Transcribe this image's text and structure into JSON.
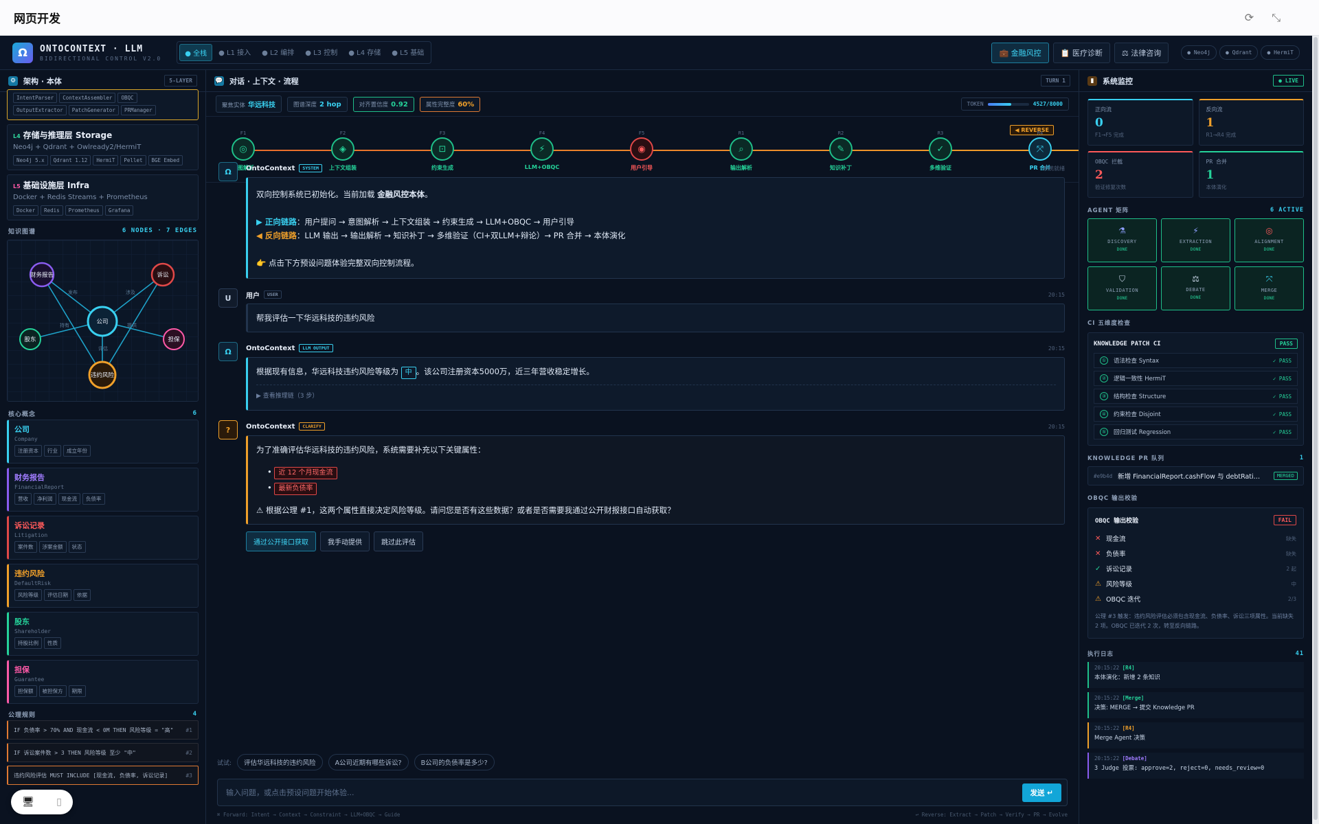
{
  "window": {
    "title": "网页开发",
    "refresh_icon": "⟳",
    "collapse_icon": "⤡"
  },
  "header": {
    "logo": "Ω",
    "name": "ONTOCONTEXT · LLM",
    "sub": "BIDIRECTIONAL CONTROL V2.0",
    "layers": [
      "● 全栈",
      "● L1 接入",
      "● L2 编排",
      "● L3 控制",
      "● L4 存储",
      "● L5 基础"
    ],
    "domains": [
      "💼 金融风控",
      "📋 医疗诊断",
      "⚖ 法律咨询"
    ],
    "services": [
      "● Neo4j",
      "● Qdrant",
      "● HermiT"
    ]
  },
  "left": {
    "title": "架构 · 本体",
    "tag": "5-LAYER",
    "top_chips": [
      "IntentParser",
      "ContextAssembler",
      "OBQC",
      "OutputExtractor",
      "PatchGenerator",
      "PRManager"
    ],
    "layers": [
      {
        "no": "L4",
        "name": "存储与推理层 Storage",
        "desc": "Neo4j + Qdrant + Owlready2/HermiT",
        "chips": [
          "Neo4j 5.x",
          "Qdrant 1.12",
          "HermiT",
          "Pellet",
          "BGE Embed"
        ],
        "color": "#2fd49c"
      },
      {
        "no": "L5",
        "name": "基础设施层 Infra",
        "desc": "Docker + Redis Streams + Prometheus",
        "chips": [
          "Docker",
          "Redis",
          "Prometheus",
          "Grafana"
        ],
        "color": "#ff5aa8"
      }
    ],
    "graph_title": "知识图谱",
    "graph_count": "6 NODES · 7 EDGES",
    "nodes": [
      {
        "label": "财务报告",
        "color": "#8a5cf0"
      },
      {
        "label": "诉讼",
        "color": "#e04848"
      },
      {
        "label": "公司",
        "color": "#39d0f0"
      },
      {
        "label": "股东",
        "color": "#25d39a"
      },
      {
        "label": "担保",
        "color": "#ff5aa8"
      },
      {
        "label": "违约风险",
        "color": "#f0a02a"
      }
    ],
    "edges": [
      "发布",
      "涉及",
      "持有",
      "提供",
      "评估"
    ],
    "concepts_title": "核心概念",
    "concepts_count": "6",
    "concepts": [
      {
        "name": "公司",
        "en": "Company",
        "attrs": [
          "注册资本",
          "行业",
          "成立年份"
        ],
        "color": "#39d0f0"
      },
      {
        "name": "财务报告",
        "en": "FinancialReport",
        "attrs": [
          "营收",
          "净利润",
          "现金流",
          "负债率"
        ],
        "color": "#8a5cf0"
      },
      {
        "name": "诉讼记录",
        "en": "Litigation",
        "attrs": [
          "案件数",
          "涉案金额",
          "状态"
        ],
        "color": "#e04848"
      },
      {
        "name": "违约风险",
        "en": "DefaultRisk",
        "attrs": [
          "风险等级",
          "评估日期",
          "依据"
        ],
        "color": "#f0a02a"
      },
      {
        "name": "股东",
        "en": "Shareholder",
        "attrs": [
          "持股比例",
          "性质"
        ],
        "color": "#25d39a"
      },
      {
        "name": "担保",
        "en": "Guarantee",
        "attrs": [
          "担保额",
          "被担保方",
          "期限"
        ],
        "color": "#ff5aa8"
      }
    ],
    "axioms_title": "公理规则",
    "axioms_count": "4",
    "axioms": [
      {
        "text": "IF 负债率 > 70% AND 现金流 < 0M THEN 风险等级 = \"高\"",
        "n": "#1"
      },
      {
        "text": "IF 诉讼案件数 > 3 THEN 风险等级 至少 \"中\"",
        "n": "#2"
      },
      {
        "text": "违约风险评估 MUST INCLUDE [现金流, 负债率, 诉讼记录]",
        "n": "#3"
      }
    ]
  },
  "center": {
    "title": "对话 · 上下文 · 流程",
    "turn": "TURN 1",
    "metrics": [
      {
        "label": "聚焦实体",
        "value": "华远科技",
        "color": "#39d0f0"
      },
      {
        "label": "图谱深度",
        "value": "2 hop",
        "color": "#39d0f0"
      },
      {
        "label": "对齐置信度",
        "value": "0.92",
        "color": "#25d39a"
      },
      {
        "label": "属性完整度",
        "value": "60%",
        "color": "#f0a02a"
      }
    ],
    "token_label": "TOKEN",
    "token_value": "4527/8000",
    "token_fill": 0.566,
    "reverse": "◀ REVERSE",
    "stages": [
      {
        "p": "F1",
        "label": "意图解析",
        "icon": "◎",
        "state": "done"
      },
      {
        "p": "F2",
        "label": "上下文组装",
        "icon": "◈",
        "state": "done"
      },
      {
        "p": "F3",
        "label": "约束生成",
        "icon": "⊡",
        "state": "done"
      },
      {
        "p": "F4",
        "label": "LLM+OBQC",
        "icon": "⚡",
        "state": "done"
      },
      {
        "p": "F5",
        "label": "用户引导",
        "icon": "◉",
        "state": "active"
      },
      {
        "p": "R1",
        "label": "输出解析",
        "icon": "⌕",
        "state": "done"
      },
      {
        "p": "R2",
        "label": "知识补丁",
        "icon": "✎",
        "state": "done"
      },
      {
        "p": "R3",
        "label": "多维验证",
        "icon": "✓",
        "state": "done"
      },
      {
        "p": "R4",
        "label": "PR 合并",
        "icon": "⤧",
        "state": "current"
      }
    ],
    "messages": {
      "m1": {
        "who": "OntoContext",
        "role": "SYSTEM",
        "time": "系统就绪",
        "l1a": "双向控制系统已初始化。当前加载 ",
        "l1b": "金融风控本体",
        "l1c": "。",
        "l2a": "▶ 正向链路",
        "l2b": "：用户提问 → 意图解析 → 上下文组装 → 约束生成 → LLM+OBQC → 用户引导",
        "l3a": "◀ 反向链路",
        "l3b": "：LLM 输出 → 输出解析 → 知识补丁 → 多维验证（CI+双LLM+辩论）→ PR 合并 → 本体演化",
        "l4": "👉 点击下方预设问题体验完整双向控制流程。"
      },
      "m2": {
        "who": "用户",
        "role": "USER",
        "time": "20:15",
        "avatar": "U",
        "text": "帮我评估一下华远科技的违约风险"
      },
      "m3": {
        "who": "OntoContext",
        "role": "LLM OUTPUT",
        "time": "20:15",
        "a": "根据现有信息，华远科技违约风险等级为 ",
        "hl": "中",
        "b": "。该公司注册资本5000万，近三年营收稳定增长。",
        "reason": "▶ 查看推理链（3 步）"
      },
      "m4": {
        "who": "OntoContext",
        "role": "CLARIFY",
        "time": "20:15",
        "avatar": "?",
        "intro": "为了准确评估华远科技的违约风险，系统需要补充以下关键属性：",
        "items": [
          "近 12 个月现金流",
          "最新负债率"
        ],
        "warn": "⚠ 根据公理 #1，这两个属性直接决定风险等级。请问您是否有这些数据？或者是否需要我通过公开财报接口自动获取？",
        "actions": [
          "通过公开接口获取",
          "我手动提供",
          "跳过此评估"
        ]
      }
    },
    "suggest_label": "试试:",
    "suggestions": [
      "评估华远科技的违约风险",
      "A公司近期有哪些诉讼?",
      "B公司的负债率是多少?"
    ],
    "input_placeholder": "输入问题，或点击预设问题开始体验...",
    "send": "发送 ↵",
    "hint_left": "⌘ Forward: Intent → Context → Constraint → LLM+OBQC → Guide",
    "hint_right": "↩ Reverse: Extract → Patch → Verify → PR → Evolve"
  },
  "right": {
    "title": "系统监控",
    "live": "● LIVE",
    "stats": [
      {
        "label": "正向流",
        "value": "0",
        "sub": "F1→F5 完成",
        "color": "#39d0f0"
      },
      {
        "label": "反向流",
        "value": "1",
        "sub": "R1→R4 完成",
        "color": "#f0a02a"
      },
      {
        "label": "OBQC 拦截",
        "value": "2",
        "sub": "验证修复次数",
        "color": "#ff5a5a"
      },
      {
        "label": "PR 合并",
        "value": "1",
        "sub": "本体演化",
        "color": "#25d39a"
      }
    ],
    "agents_title": "AGENT 矩阵",
    "agents_count": "6 ACTIVE",
    "agents": [
      {
        "icon": "⚗",
        "name": "DISCOVERY",
        "state": "DONE"
      },
      {
        "icon": "⚡",
        "name": "EXTRACTION",
        "state": "DONE"
      },
      {
        "icon": "◎",
        "name": "ALIGNMENT",
        "state": "DONE"
      },
      {
        "icon": "⛉",
        "name": "VALIDATION",
        "state": "DONE"
      },
      {
        "icon": "⚖",
        "name": "DEBATE",
        "state": "DONE"
      },
      {
        "icon": "⤧",
        "name": "MERGE",
        "state": "DONE"
      }
    ],
    "ci_title": "CI 五维度检查",
    "ci_box": "KNOWLEDGE PATCH CI",
    "ci_status": "PASS",
    "ci_rows": [
      {
        "name": "语法检查 Syntax",
        "res": "✓ PASS"
      },
      {
        "name": "逻辑一致性 HermiT",
        "res": "✓ PASS"
      },
      {
        "name": "结构检查 Structure",
        "res": "✓ PASS"
      },
      {
        "name": "约束检查 Disjoint",
        "res": "✓ PASS"
      },
      {
        "name": "回归测试 Regression",
        "res": "✓ PASS"
      }
    ],
    "pr_title": "KNOWLEDGE PR 队列",
    "pr_count": "1",
    "pr": {
      "id": "#e9b4d",
      "text": "新增 FinancialReport.cashFlow 与 debtRati…",
      "state": "MERGED"
    },
    "obqc_title": "OBQC 输出校验",
    "obqc_box": "OBQC 输出校验",
    "obqc_status": "FAIL",
    "obqc_rows": [
      {
        "icon": "✕",
        "name": "现金流",
        "val": "缺失",
        "color": "#ff5a5a"
      },
      {
        "icon": "✕",
        "name": "负债率",
        "val": "缺失",
        "color": "#ff5a5a"
      },
      {
        "icon": "✓",
        "name": "诉讼记录",
        "val": "2 起",
        "color": "#25d39a"
      },
      {
        "icon": "⚠",
        "name": "风险等级",
        "val": "中",
        "color": "#f0a02a"
      },
      {
        "icon": "⚠",
        "name": "OBQC 迭代",
        "val": "2/3",
        "color": "#f0a02a"
      }
    ],
    "obqc_note": "公理 #3 触发：违约风险评估必须包含现金流、负债率、诉讼三项属性。当前缺失 2 项。OBQC 已迭代 2 次，转至反向链路。",
    "log_title": "执行日志",
    "log_count": "41",
    "logs": [
      {
        "t": "20:15:22",
        "tag": "[R4]",
        "msg": "本体演化：新增 2 条知识",
        "color": "#25d39a"
      },
      {
        "t": "20:15:22",
        "tag": "[Merge]",
        "msg": "决策: MERGE → 提交 Knowledge PR",
        "color": "#25d39a"
      },
      {
        "t": "20:15:22",
        "tag": "[R4]",
        "msg": "Merge Agent 决策",
        "color": "#f0a02a"
      },
      {
        "t": "20:15:22",
        "tag": "[Debate]",
        "msg": "3 Judge 投票: approve=2, reject=0, needs_review=0",
        "color": "#8a5cf0"
      }
    ]
  },
  "float": {
    "desktop_icon": "🖥",
    "mobile_icon": "▯"
  }
}
